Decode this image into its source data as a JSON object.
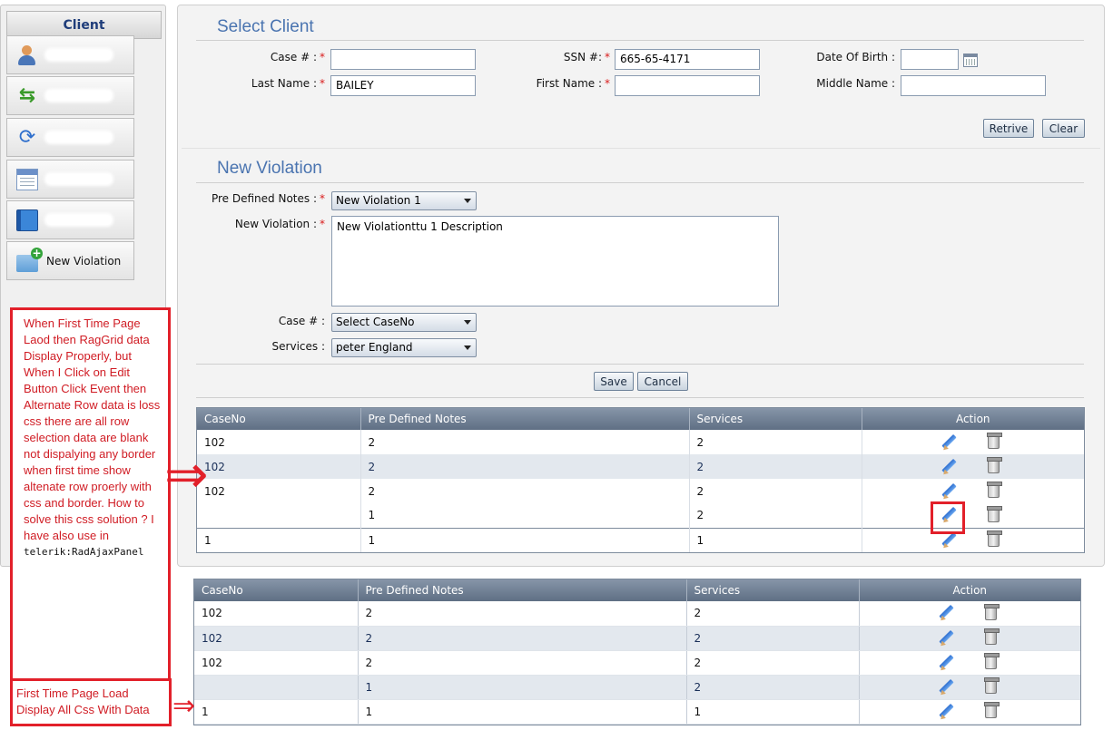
{
  "sidebar": {
    "title": "Client",
    "items": [
      {
        "icon": "user-info-icon",
        "label": ""
      },
      {
        "icon": "transfer-arrows-icon",
        "label": ""
      },
      {
        "icon": "refresh-icon",
        "label": ""
      },
      {
        "icon": "calendar-list-icon",
        "label": ""
      },
      {
        "icon": "book-icon",
        "label": ""
      },
      {
        "icon": "folder-add-icon",
        "label": "New Violation"
      }
    ]
  },
  "select_client": {
    "title": "Select Client",
    "case_label": "Case # :",
    "case_value": "",
    "ssn_label": "SSN #:",
    "ssn_value": "665-65-4171",
    "dob_label": "Date Of Birth :",
    "dob_value": "",
    "last_name_label": "Last Name :",
    "last_name_value": "BAILEY",
    "first_name_label": "First Name :",
    "first_name_value": "",
    "middle_name_label": "Middle Name :",
    "middle_name_value": "",
    "required_mark": "*",
    "retrive_label": "Retrive",
    "clear_label": "Clear"
  },
  "new_violation": {
    "title": "New Violation",
    "notes_label": "Pre Defined Notes :",
    "notes_value": "New Violation 1",
    "violation_label": "New Violation :",
    "violation_value": "New Violationttu 1 Description",
    "case_label": "Case # :",
    "case_value": "Select CaseNo",
    "services_label": "Services :",
    "services_value": "peter England",
    "save_label": "Save",
    "cancel_label": "Cancel"
  },
  "grid_columns": [
    "CaseNo",
    "Pre Defined Notes",
    "Services",
    "Action"
  ],
  "grid_rows": [
    [
      "102",
      "2",
      "2"
    ],
    [
      "102",
      "2",
      "2"
    ],
    [
      "102",
      "2",
      "2"
    ],
    [
      "",
      "1",
      "2"
    ],
    [
      "1",
      "1",
      "1"
    ]
  ],
  "annotations": {
    "problem_text": "When First Time Page Laod then RagGrid data Display Properly, but When I Click on Edit Button Click Event then Alternate Row data is loss css there are all row selection data are blank not dispalying any border when first time show altenate row proerly with css and border.  How to solve this css solution ?  I have  also use in",
    "problem_code": "telerik:RadAjaxPanel",
    "first_load_text": "First Time Page Load Display All Css With Data",
    "arrow": "⇒"
  },
  "colors": {
    "accent": "#4a74b0",
    "annotation_red": "#e2202a",
    "grid_header": "#6f7f94",
    "alt_row": "#e3e8ee"
  }
}
